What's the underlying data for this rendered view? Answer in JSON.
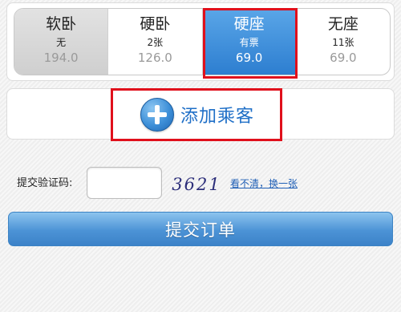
{
  "seats": [
    {
      "name": "软卧",
      "count": "无",
      "price": "194.0",
      "state": "disabled"
    },
    {
      "name": "硬卧",
      "count": "2张",
      "price": "126.0",
      "state": "normal"
    },
    {
      "name": "硬座",
      "count": "有票",
      "price": "69.0",
      "state": "selected"
    },
    {
      "name": "无座",
      "count": "11张",
      "price": "69.0",
      "state": "normal"
    }
  ],
  "add_passenger": {
    "label": "添加乘客",
    "icon": "plus-circle-icon"
  },
  "captcha": {
    "label": "提交验证码:",
    "input_value": "",
    "code": "3621",
    "refresh_label": "看不清，换一张"
  },
  "submit": {
    "label": "提交订单"
  },
  "colors": {
    "accent": "#2d7ed0",
    "highlight_frame": "#e0101c",
    "link": "#1f5fb6"
  }
}
